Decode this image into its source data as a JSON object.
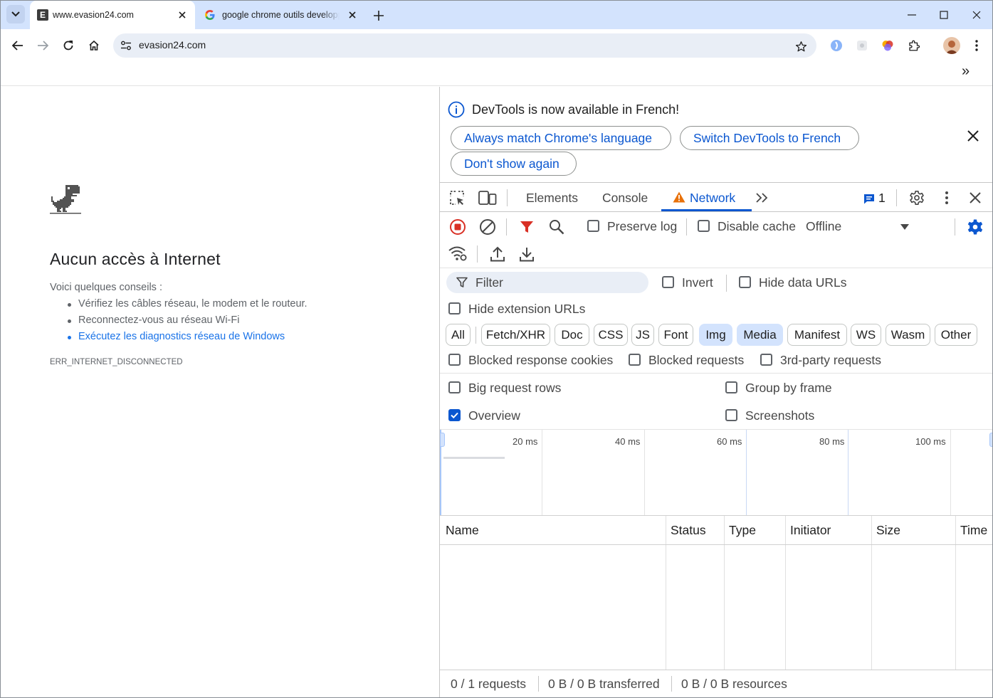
{
  "tabs": [
    {
      "title": "www.evasion24.com",
      "favicon": "E"
    },
    {
      "title": "google chrome outils developpeur"
    }
  ],
  "address": {
    "url": "evasion24.com"
  },
  "bookmarks": {
    "overflow": "»"
  },
  "error_page": {
    "title": "Aucun accès à Internet",
    "intro": "Voici quelques conseils :",
    "tips": [
      "Vérifiez les câbles réseau, le modem et le routeur.",
      "Reconnectez-vous au réseau Wi-Fi",
      "Exécutez les diagnostics réseau de Windows"
    ],
    "error_code": "ERR_INTERNET_DISCONNECTED"
  },
  "devtools": {
    "banner": {
      "message": "DevTools is now available in French!",
      "btn_match": "Always match Chrome's language",
      "btn_switch": "Switch DevTools to French",
      "btn_dont_show": "Don't show again"
    },
    "tabs": [
      "Elements",
      "Console",
      "Network"
    ],
    "issues_count": "1",
    "toolbar": {
      "preserve_log": "Preserve log",
      "disable_cache": "Disable cache",
      "throttle": "Offline"
    },
    "filter": {
      "placeholder": "Filter",
      "invert": "Invert",
      "hide_data_urls": "Hide data URLs",
      "hide_extension_urls": "Hide extension URLs"
    },
    "type_chips": [
      {
        "label": "All",
        "selected": false
      },
      {
        "label": "Fetch/XHR",
        "selected": false
      },
      {
        "label": "Doc",
        "selected": false
      },
      {
        "label": "CSS",
        "selected": false
      },
      {
        "label": "JS",
        "selected": false
      },
      {
        "label": "Font",
        "selected": false
      },
      {
        "label": "Img",
        "selected": true
      },
      {
        "label": "Media",
        "selected": true
      },
      {
        "label": "Manifest",
        "selected": false
      },
      {
        "label": "WS",
        "selected": false
      },
      {
        "label": "Wasm",
        "selected": false
      },
      {
        "label": "Other",
        "selected": false
      }
    ],
    "blocked": {
      "response_cookies": "Blocked response cookies",
      "requests": "Blocked requests",
      "third_party": "3rd-party requests"
    },
    "settings": {
      "big_rows": "Big request rows",
      "group_by_frame": "Group by frame",
      "overview": "Overview",
      "overview_checked": true,
      "screenshots": "Screenshots"
    },
    "timeline_ticks": [
      "20 ms",
      "40 ms",
      "60 ms",
      "80 ms",
      "100 ms"
    ],
    "columns": [
      "Name",
      "Status",
      "Type",
      "Initiator",
      "Size",
      "Time"
    ],
    "status": {
      "requests": "0 / 1 requests",
      "transferred": "0 B / 0 B transferred",
      "resources": "0 B / 0 B resources"
    }
  },
  "colors": {
    "accent": "#0b57d0",
    "tabstrip": "#d3e3fd",
    "record": "#d93025",
    "warning": "#e8710a"
  }
}
